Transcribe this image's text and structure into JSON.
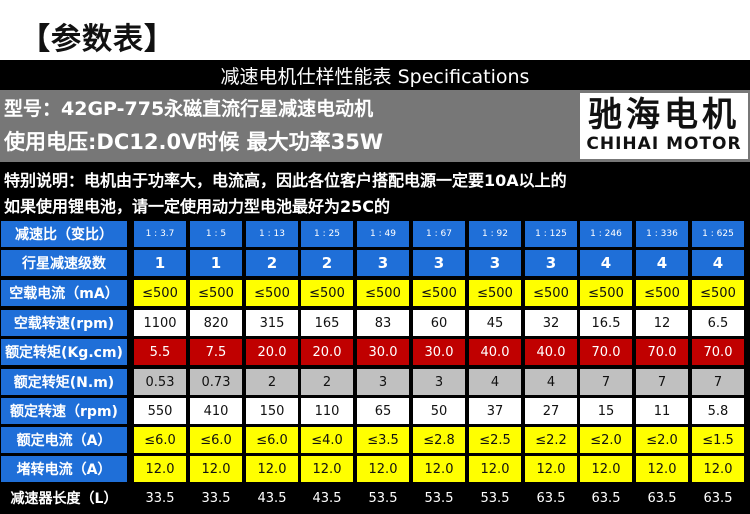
{
  "heading": "【参数表】",
  "spec_bar": "减速电机仕样性能表 Specifications",
  "title": {
    "model": "型号：42GP-775永磁直流行星减速电动机",
    "voltage": "使用电压:DC12.0V时候 最大功率35W"
  },
  "logo": {
    "cn": "驰海电机",
    "en": "CHIHAI MOTOR"
  },
  "notes": [
    "特别说明：电机由于功率大，电流高，因此各位客户搭配电源一定要10A以上的",
    "如果使用锂电池，请一定使用动力型电池最好为25C的"
  ],
  "table": {
    "rows": [
      {
        "label": "减速比（变比）",
        "style": "blue small",
        "values": [
          "1 : 3.7",
          "1 : 5",
          "1 : 13",
          "1 : 25",
          "1 : 49",
          "1 : 67",
          "1 : 92",
          "1 : 125",
          "1 : 246",
          "1 : 336",
          "1 : 625"
        ]
      },
      {
        "label": "行星减速级数",
        "style": "blue big",
        "values": [
          "1",
          "1",
          "2",
          "2",
          "3",
          "3",
          "3",
          "3",
          "4",
          "4",
          "4"
        ]
      },
      {
        "label": "空载电流（mA）",
        "style": "yellow",
        "values": [
          "≤500",
          "≤500",
          "≤500",
          "≤500",
          "≤500",
          "≤500",
          "≤500",
          "≤500",
          "≤500",
          "≤500",
          "≤500"
        ]
      },
      {
        "label": "空载转速(rpm)",
        "style": "white",
        "values": [
          "1100",
          "820",
          "315",
          "165",
          "83",
          "60",
          "45",
          "32",
          "16.5",
          "12",
          "6.5"
        ]
      },
      {
        "label": "额定转矩(Kg.cm)",
        "style": "red",
        "values": [
          "5.5",
          "7.5",
          "20.0",
          "20.0",
          "30.0",
          "30.0",
          "40.0",
          "40.0",
          "70.0",
          "70.0",
          "70.0"
        ]
      },
      {
        "label": "额定转矩(N.m)",
        "style": "gray",
        "values": [
          "0.53",
          "0.73",
          "2",
          "2",
          "3",
          "3",
          "4",
          "4",
          "7",
          "7",
          "7"
        ]
      },
      {
        "label": "额定转速（rpm)",
        "style": "white",
        "values": [
          "550",
          "410",
          "150",
          "110",
          "65",
          "50",
          "37",
          "27",
          "15",
          "11",
          "5.8"
        ]
      },
      {
        "label": "额定电流（A）",
        "style": "yellow",
        "values": [
          "≤6.0",
          "≤6.0",
          "≤6.0",
          "≤4.0",
          "≤3.5",
          "≤2.8",
          "≤2.5",
          "≤2.2",
          "≤2.0",
          "≤2.0",
          "≤1.5"
        ]
      },
      {
        "label": "堵转电流（A）",
        "style": "yellow",
        "values": [
          "12.0",
          "12.0",
          "12.0",
          "12.0",
          "12.0",
          "12.0",
          "12.0",
          "12.0",
          "12.0",
          "12.0",
          "12.0"
        ]
      },
      {
        "label": "减速器长度（L）",
        "style": "black",
        "values": [
          "33.5",
          "33.5",
          "43.5",
          "43.5",
          "53.5",
          "53.5",
          "53.5",
          "63.5",
          "63.5",
          "63.5",
          "63.5"
        ]
      }
    ]
  }
}
